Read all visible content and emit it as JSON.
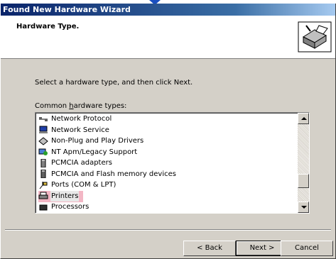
{
  "window": {
    "title": "Found New Hardware Wizard"
  },
  "header": {
    "title": "Hardware Type.",
    "icon": "hardware-wizard-icon"
  },
  "main": {
    "instruction": "Select a hardware type, and then click Next.",
    "list_caption": "Common hardware types:",
    "items": [
      {
        "label": "Network Protocol",
        "icon": "network-protocol-icon"
      },
      {
        "label": "Network Service",
        "icon": "network-service-icon"
      },
      {
        "label": "Non-Plug and Play Drivers",
        "icon": "non-pnp-driver-icon"
      },
      {
        "label": "NT Apm/Legacy Support",
        "icon": "apm-legacy-icon"
      },
      {
        "label": "PCMCIA adapters",
        "icon": "pcmcia-adapter-icon"
      },
      {
        "label": "PCMCIA and Flash memory devices",
        "icon": "pcmcia-flash-icon"
      },
      {
        "label": "Ports (COM & LPT)",
        "icon": "ports-icon"
      },
      {
        "label": "Printers",
        "icon": "printer-icon"
      },
      {
        "label": "Processors",
        "icon": "processor-icon"
      }
    ],
    "selected_item": "Printers"
  },
  "buttons": {
    "back": "< Back",
    "next": "Next >",
    "cancel": "Cancel"
  }
}
